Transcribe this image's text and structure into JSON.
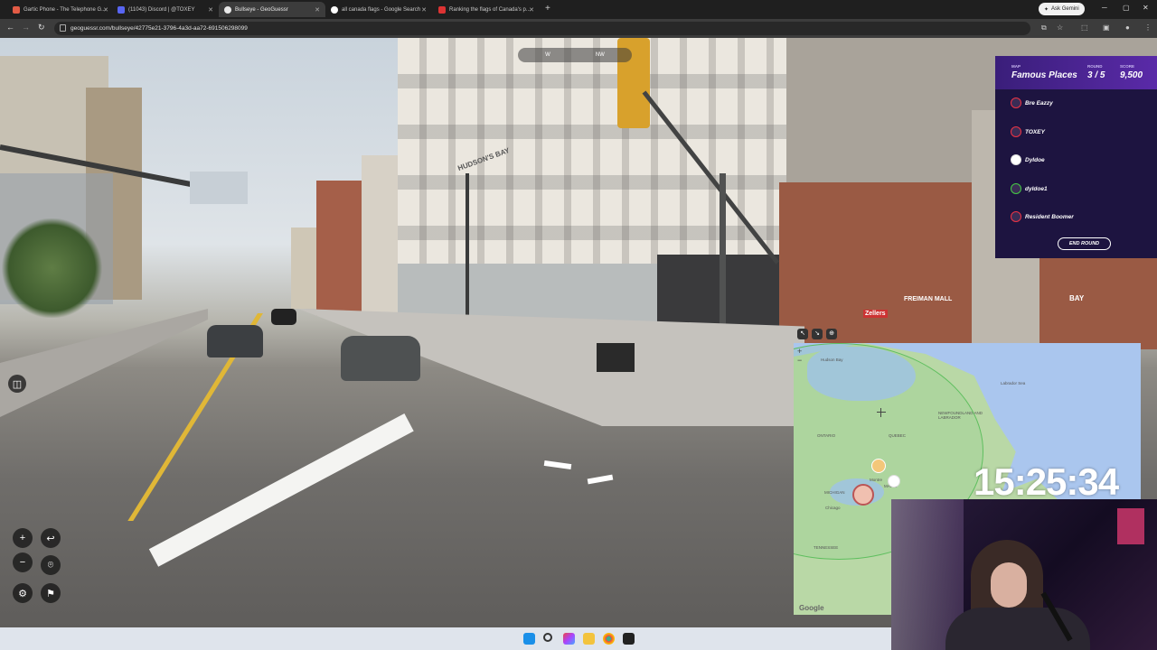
{
  "browser": {
    "tabs": [
      {
        "label": "Gartic Phone - The Telephone G...",
        "color": "#e25b45"
      },
      {
        "label": "(11043) Discord | @TOXEY",
        "color": "#5865f2"
      },
      {
        "label": "Bullseye - GeoGuessr",
        "color": "#e9e9e9"
      },
      {
        "label": "all canada flags - Google Search",
        "color": "#ffffff"
      },
      {
        "label": "Ranking the flags of Canada's p...",
        "color": "#d33"
      }
    ],
    "new_tab_icon": "+",
    "ask_gemini": "Ask Gemini",
    "address": "geoguessr.com/bullseye/42775e21-3796-4a3d-aa72-691506298099"
  },
  "compass": {
    "west": "W",
    "northwest": "NW"
  },
  "game": {
    "map_label": "MAP",
    "map_name": "Famous Places",
    "round_label": "ROUND",
    "round_value": "3 / 5",
    "score_label": "SCORE",
    "score_value": "9,500",
    "players": [
      "Bre Eazzy",
      "TOXEY",
      "Dyldoe",
      "dyldoe1",
      "Resident Boomer"
    ],
    "end_round": "END ROUND"
  },
  "map": {
    "labels": [
      "Hudson Bay",
      "Labrador Sea",
      "NEWFOUNDLAND AND LABRADOR",
      "ONTARIO",
      "QUEBEC",
      "MICHIGAN",
      "Chicago",
      "TENNESSEE",
      "Montre",
      "MAINE"
    ],
    "google": "Google",
    "zoom_in": "+",
    "zoom_out": "−"
  },
  "timer": "15:25:34",
  "street_signs": {
    "store": "HUDSON'S BAY",
    "mall": "FREIMAN MALL",
    "zellers": "Zellers",
    "bay": "BAY"
  },
  "colors": {
    "scoreboard_bg": "#1d1440",
    "accent": "#5a2aa8",
    "map_water": "#aac6ee",
    "map_land": "#b9d8a6"
  }
}
